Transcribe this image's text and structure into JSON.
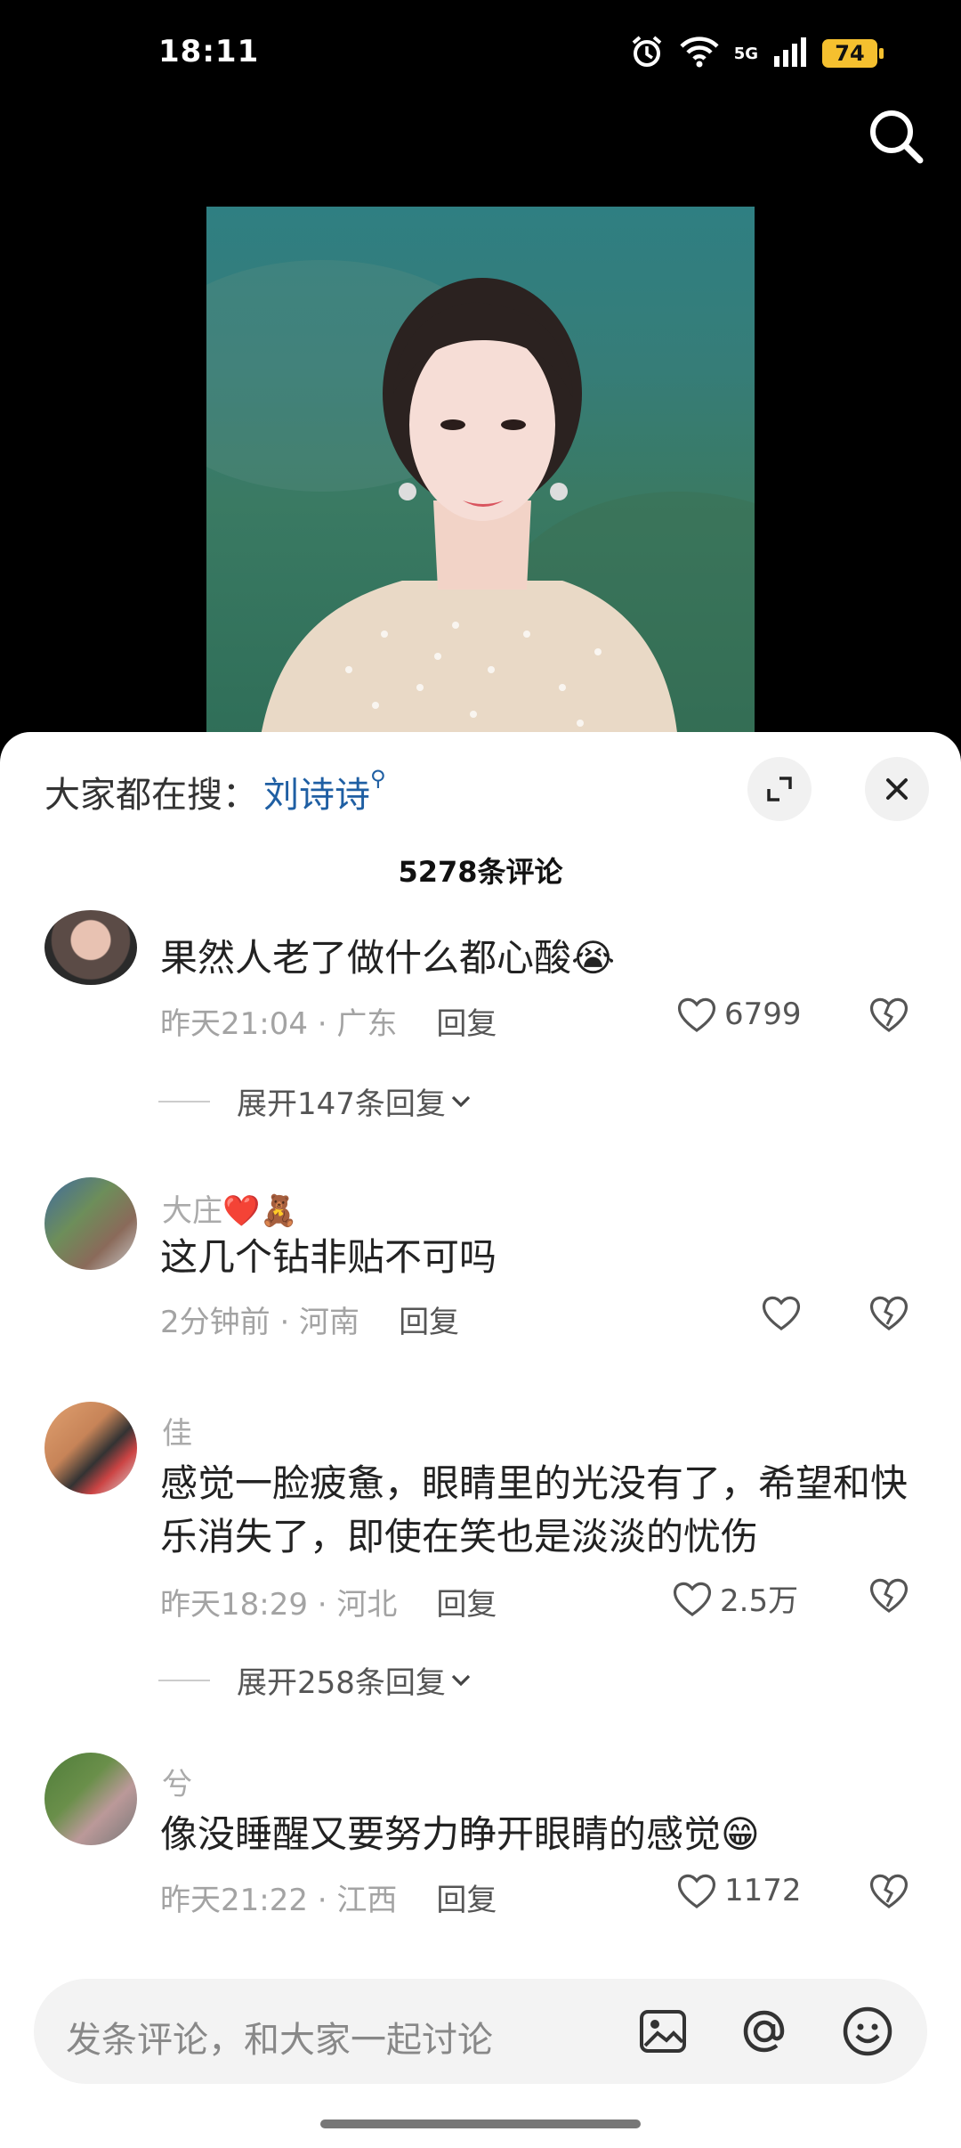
{
  "status_bar": {
    "time": "18:11",
    "network": "5G",
    "battery": "74"
  },
  "sheet": {
    "search_hint_label": "大家都在搜：",
    "search_hint_term": "刘诗诗",
    "comment_count": "5278条评论"
  },
  "comments": [
    {
      "username": "",
      "text": "果然人老了做什么都心酸😭",
      "time_loc": "昨天21:04 · 广东",
      "reply": "回复",
      "likes": "6799",
      "expand": "展开147条回复"
    },
    {
      "username": "大庄❤️🧸",
      "text": "这几个钻非贴不可吗",
      "time_loc": "2分钟前 · 河南",
      "reply": "回复",
      "likes": ""
    },
    {
      "username": "佳",
      "text": "感觉一脸疲惫，眼睛里的光没有了，希望和快乐消失了，即使在笑也是淡淡的忧伤",
      "time_loc": "昨天18:29 · 河北",
      "reply": "回复",
      "likes": "2.5万",
      "expand": "展开258条回复"
    },
    {
      "username": "兮",
      "text": "像没睡醒又要努力睁开眼睛的感觉😁",
      "time_loc": "昨天21:22 · 江西",
      "reply": "回复",
      "likes": "1172"
    }
  ],
  "input": {
    "placeholder": "发条评论，和大家一起讨论"
  },
  "icons": [
    "alarm-icon",
    "wifi-icon",
    "signal-icon",
    "battery-icon",
    "search-icon",
    "expand-icon",
    "close-icon",
    "heart-icon",
    "broken-heart-icon",
    "chevron-down-icon",
    "image-icon",
    "at-icon",
    "emoji-icon"
  ]
}
